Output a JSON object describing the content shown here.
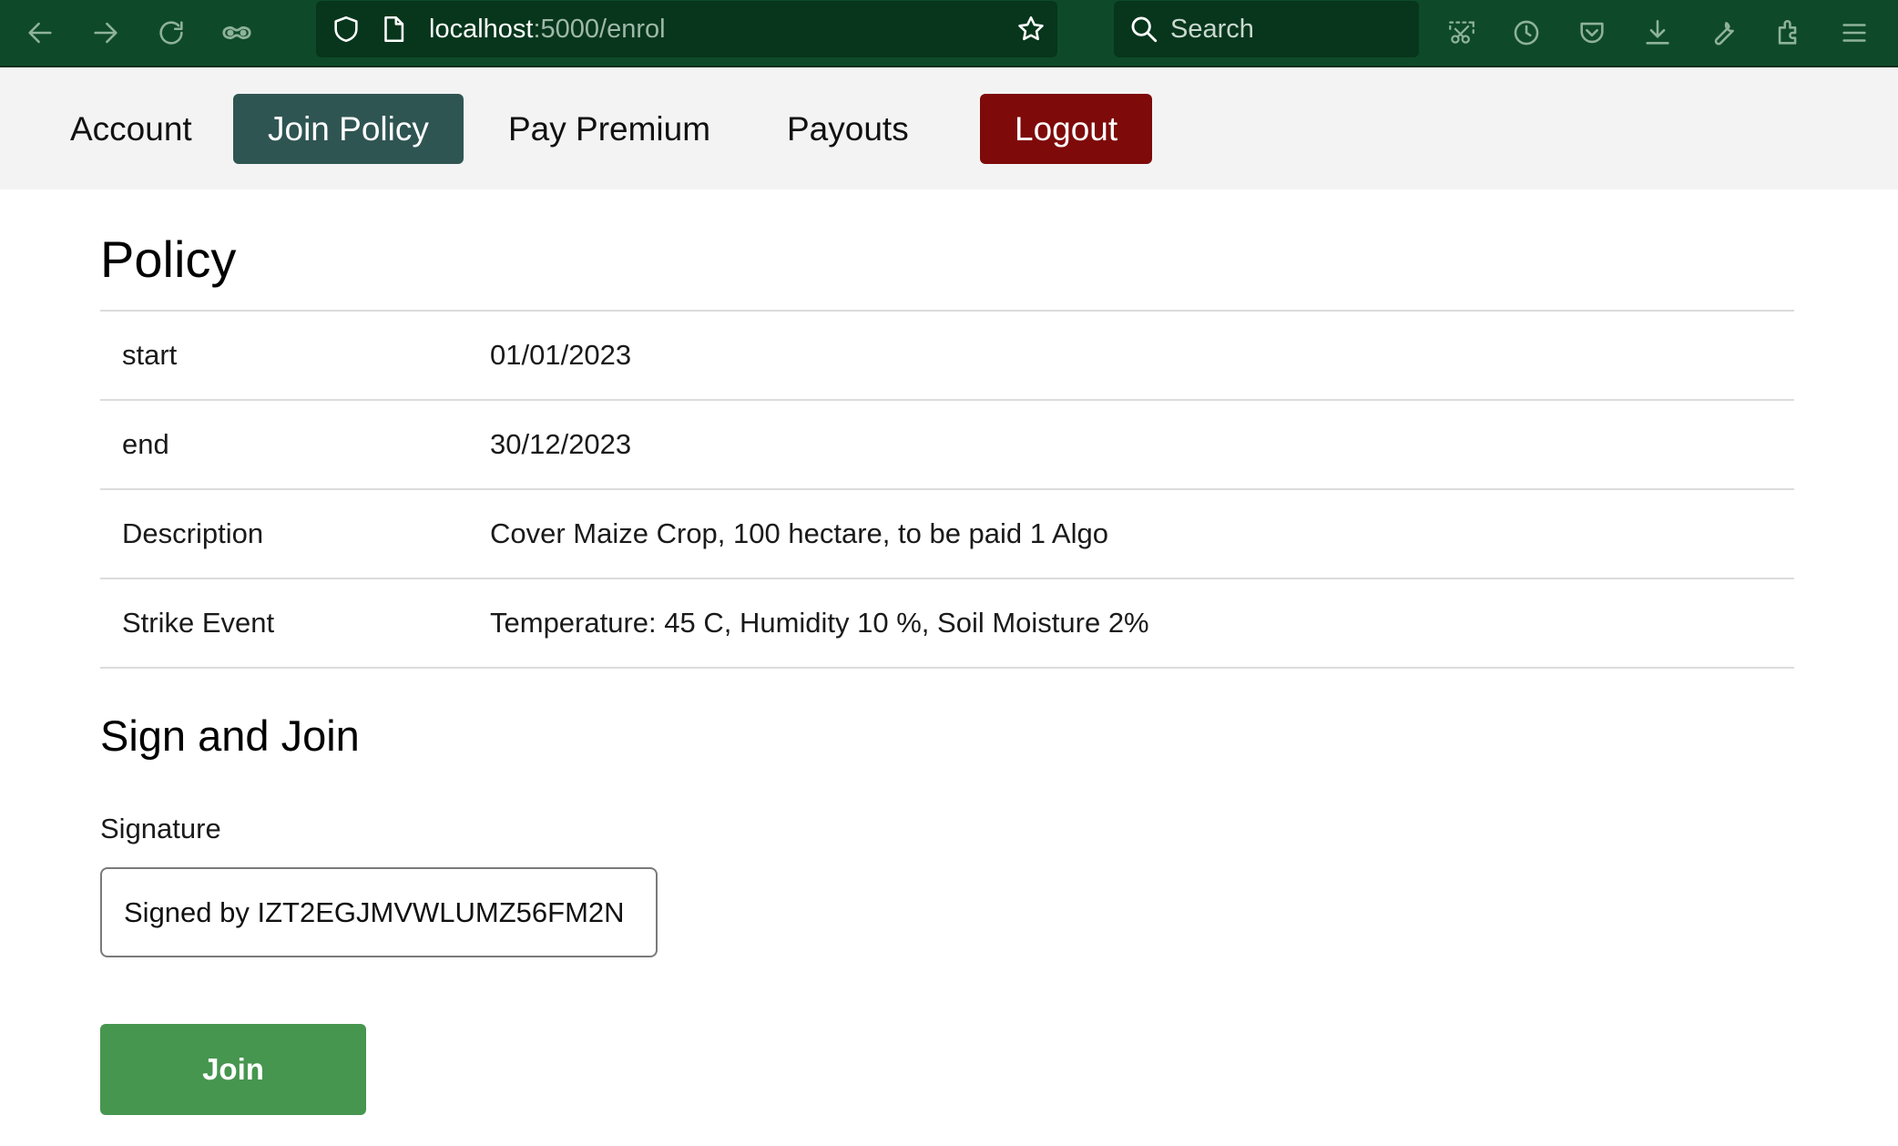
{
  "browser": {
    "url_host": "localhost",
    "url_path": ":5000/enrol",
    "search_placeholder": "Search",
    "icons": [
      "back-arrow-icon",
      "forward-arrow-icon",
      "reload-icon",
      "private-mask-icon",
      "shield-icon",
      "page-icon",
      "bookmark-star-icon",
      "search-icon",
      "screenshot-icon",
      "history-clock-icon",
      "pocket-icon",
      "download-icon",
      "wrench-icon",
      "extensions-icon",
      "hamburger-menu-icon"
    ]
  },
  "nav": {
    "items": [
      {
        "label": "Account"
      },
      {
        "label": "Join Policy",
        "active": true
      },
      {
        "label": "Pay Premium"
      },
      {
        "label": "Payouts"
      },
      {
        "label": "Logout"
      }
    ]
  },
  "policy": {
    "title": "Policy",
    "rows": [
      {
        "key": "start",
        "value": "01/01/2023"
      },
      {
        "key": "end",
        "value": "30/12/2023"
      },
      {
        "key": "Description",
        "value": "Cover Maize Crop, 100 hectare, to be paid 1 Algo"
      },
      {
        "key": "Strike Event",
        "value": "Temperature: 45 C, Humidity 10 %, Soil Moisture 2%"
      }
    ]
  },
  "sign": {
    "title": "Sign and Join",
    "signature_label": "Signature",
    "signature_value": "Signed by IZT2EGJMVWLUMZ56FM2N",
    "join_label": "Join"
  },
  "colors": {
    "chrome_bg": "#0e4a2a",
    "nav_bg": "#f3f3f3",
    "active_tab": "#2f5553",
    "logout": "#7e0a0a",
    "join_button": "#46964f"
  }
}
